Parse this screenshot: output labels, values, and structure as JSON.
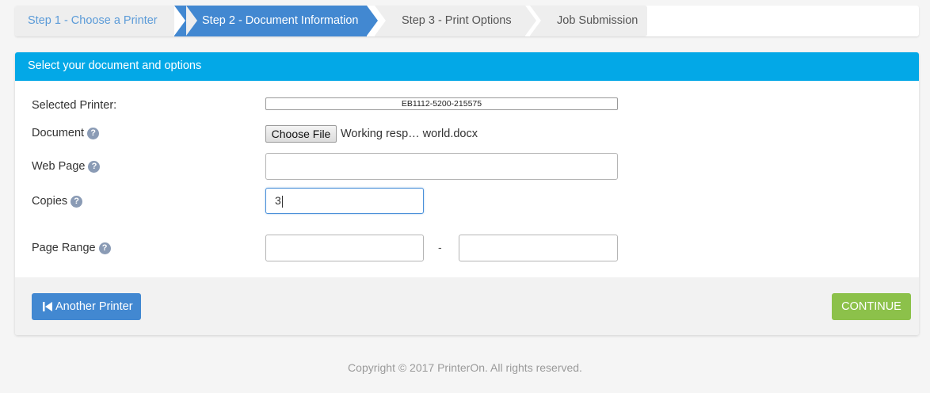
{
  "steps": [
    {
      "label": "Step 1 - Choose a Printer",
      "state": "complete"
    },
    {
      "label": "Step 2 - Document Information",
      "state": "active"
    },
    {
      "label": "Step 3 - Print Options",
      "state": "pending"
    },
    {
      "label": "Job Submission",
      "state": "pending"
    }
  ],
  "panel": {
    "title": "Select your document and options"
  },
  "form": {
    "printer_label": "Selected Printer:",
    "printer_value": "EB1112-5200-215575",
    "document_label": "Document",
    "choose_file_label": "Choose File",
    "file_name": "Working resp… world.docx",
    "webpage_label": "Web Page",
    "webpage_value": "",
    "copies_label": "Copies",
    "copies_value": "3",
    "page_range_label": "Page Range",
    "page_range_from": "",
    "page_range_separator": "-",
    "page_range_to": "",
    "help_glyph": "?"
  },
  "footer": {
    "back_label": "Another Printer",
    "continue_label": "CONTINUE"
  },
  "copyright": "Copyright © 2017 PrinterOn. All rights reserved.",
  "colors": {
    "active_step": "#4288d1",
    "header": "#03a8e7",
    "continue": "#8cc14a",
    "back": "#4288d1"
  },
  "icons": {
    "help": "question-circle-icon",
    "back": "skip-back-icon"
  }
}
